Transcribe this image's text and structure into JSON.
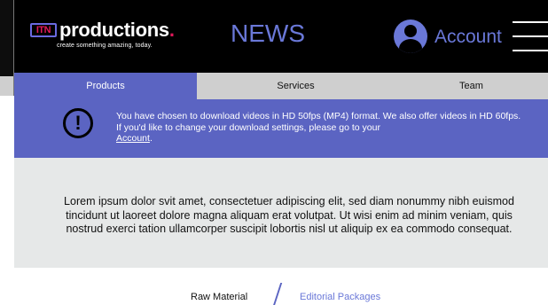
{
  "header": {
    "logo": {
      "prefix": "ITN",
      "word": "productions",
      "dot": ".",
      "tagline": "create something amazing, today."
    },
    "title": "NEWS",
    "account_label": "Account"
  },
  "tabs": [
    {
      "label": "Products",
      "active": true
    },
    {
      "label": "Services",
      "active": false
    },
    {
      "label": "Team",
      "active": false
    }
  ],
  "notice": {
    "text": "You have chosen to download videos in HD 50fps (MP4) format. We also offer videos in HD 60fps. If you'd like to change your download settings, please go to your",
    "link_label": "Account",
    "suffix": "."
  },
  "content": {
    "body": "Lorem ipsum dolor svit amet, consectetuer adipiscing elit, sed diam nonummy nibh euismod tincidunt ut laoreet dolore magna aliquam erat volutpat. Ut wisi enim ad minim veniam, quis nostrud exerci tation ullamcorper suscipit lobortis nisl ut aliquip ex ea commodo consequat."
  },
  "footer_nav": {
    "items": [
      {
        "label": "Raw Material"
      },
      {
        "label": "Editorial Packages"
      }
    ]
  },
  "colors": {
    "accent": "#5b64c2",
    "accent_text": "#6a78d8",
    "brand_red": "#e0185a",
    "header_bg": "#000000",
    "tab_inactive": "#cfcfcf",
    "content_bg": "#e6e8e8"
  },
  "icons": {
    "notice": "exclamation-circle-icon",
    "account": "user-avatar-icon",
    "menu": "hamburger-menu-icon"
  }
}
